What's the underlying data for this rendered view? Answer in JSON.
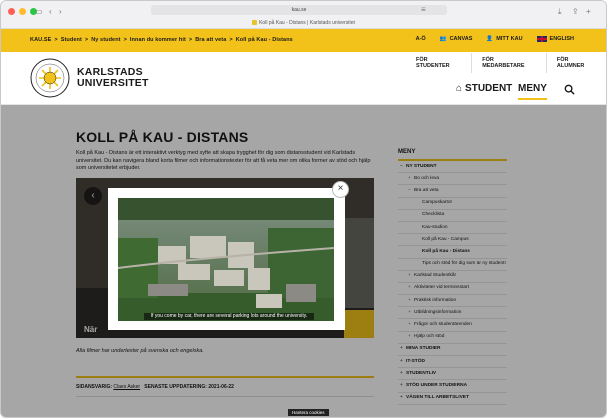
{
  "browser": {
    "url": "kau.se",
    "tab_title": "Koll på Kau - Distans | Karlstads universitet"
  },
  "topbar": {
    "breadcrumb": [
      "KAU.SE",
      ">",
      "Student",
      ">",
      "Ny student",
      ">",
      "Innan du kommer hit",
      ">",
      "Bra att veta",
      ">",
      "Koll på Kau - Distans"
    ],
    "links": {
      "ao": "A-Ö",
      "canvas": "CANVAS",
      "mitt_kau": "MITT KAU",
      "english": "ENGLISH"
    }
  },
  "header": {
    "uni_line1": "KARLSTADS",
    "uni_line2": "UNIVERSITET",
    "tabs": [
      "FÖR STUDENTER",
      "FÖR MEDARBETARE",
      "FÖR ALUMNER"
    ],
    "student": "STUDENT",
    "meny": "MENY"
  },
  "main": {
    "title": "KOLL PÅ KAU - DISTANS",
    "intro": "Koll på Kau - Distans är ett interaktivt verktyg med syfte att skapa trygghet för dig som distansstudent vid Karlstads universitet. Du kan navigera bland korta filmer och informationstexter för att få veta mer om olika former av stöd och hjälp som universitetet erbjuder.",
    "video_text": "När",
    "caption": "Alla filmer har undertexter på svenska och engelska.",
    "responsible_label": "SIDANSVARIG:",
    "responsible_name": "Claes Asker",
    "updated_label": "SENASTE UPPDATERING:",
    "updated_date": "2021-06-22"
  },
  "modal": {
    "subtitle": "If you come by car, there are several parking lots around the university.",
    "close": "×"
  },
  "sidebar": {
    "title": "MENY",
    "items": [
      {
        "label": "NY STUDENT",
        "level": 0,
        "sign": "−"
      },
      {
        "label": "Bo och leva",
        "level": 1,
        "sign": "+"
      },
      {
        "label": "Bra att veta",
        "level": 1,
        "sign": "−"
      },
      {
        "label": "Campuskartor",
        "level": 2,
        "sign": ""
      },
      {
        "label": "Checklista",
        "level": 2,
        "sign": ""
      },
      {
        "label": "Kau-studion",
        "level": 2,
        "sign": ""
      },
      {
        "label": "Koll på Kau - Campus",
        "level": 2,
        "sign": ""
      },
      {
        "label": "Koll på Kau - Distans",
        "level": 2,
        "sign": "",
        "active": true
      },
      {
        "label": "Tips och stöd för dig som är ny student!",
        "level": 2,
        "sign": ""
      },
      {
        "label": "Karlstad Studentkår",
        "level": 1,
        "sign": "+"
      },
      {
        "label": "Aktiviteter vid terminsstart",
        "level": 1,
        "sign": "+"
      },
      {
        "label": "Praktisk information",
        "level": 1,
        "sign": "+"
      },
      {
        "label": "Utbildningsinformation",
        "level": 1,
        "sign": "+"
      },
      {
        "label": "Frågor och studentärenden",
        "level": 1,
        "sign": "+"
      },
      {
        "label": "Hjälp och stöd",
        "level": 1,
        "sign": "+"
      },
      {
        "label": "MINA STUDIER",
        "level": 0,
        "sign": "+"
      },
      {
        "label": "IT-STÖD",
        "level": 0,
        "sign": "+"
      },
      {
        "label": "STUDENTLIV",
        "level": 0,
        "sign": "+"
      },
      {
        "label": "STÖD UNDER STUDIERNA",
        "level": 0,
        "sign": "+"
      },
      {
        "label": "VÄGEN TILL ARBETSLIVET",
        "level": 0,
        "sign": "+"
      }
    ]
  },
  "cookie": "Hantera cookies",
  "colors": {
    "brand_yellow": "#f2c21b"
  }
}
